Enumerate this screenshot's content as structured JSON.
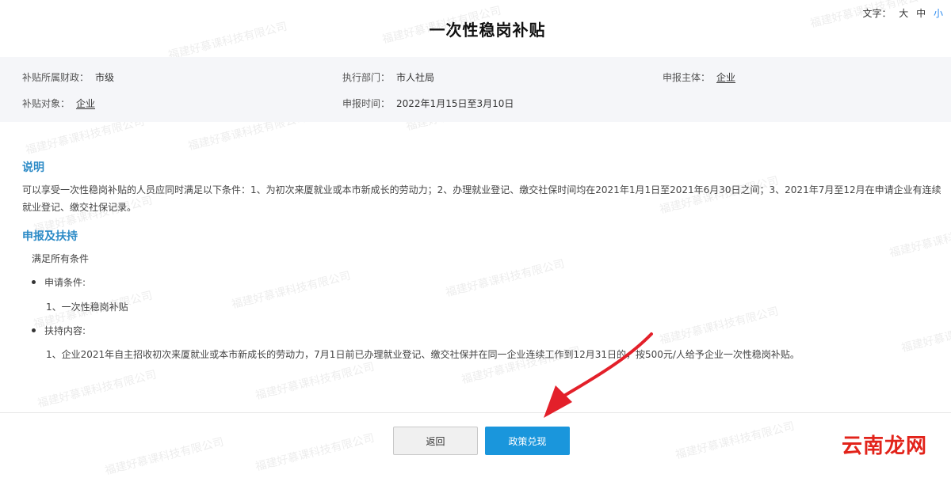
{
  "font_switch": {
    "label": "文字：",
    "large": "大",
    "medium": "中",
    "small": "小"
  },
  "title": "一次性稳岗补贴",
  "meta": {
    "finance": {
      "key": "补贴所属财政：",
      "value": "市级"
    },
    "dept": {
      "key": "执行部门：",
      "value": "市人社局"
    },
    "applicant": {
      "key": "申报主体：",
      "value": "企业"
    },
    "target": {
      "key": "补贴对象：",
      "value": "企业"
    },
    "time": {
      "key": "申报时间：",
      "value": "2022年1月15日至3月10日"
    }
  },
  "explain": {
    "title": "说明",
    "text": "可以享受一次性稳岗补贴的人员应同时满足以下条件：1、为初次来厦就业或本市新成长的劳动力；2、办理就业登记、缴交社保时间均在2021年1月1日至2021年6月30日之间；3、2021年7月至12月在申请企业有连续就业登记、缴交社保记录。"
  },
  "support": {
    "title": "申报及扶持",
    "condition_all": "满足所有条件",
    "apply_label": "申请条件:",
    "apply_item": "1、一次性稳岗补贴",
    "support_label": "扶持内容:",
    "support_item": "1、企业2021年自主招收初次来厦就业或本市新成长的劳动力，7月1日前已办理就业登记、缴交社保并在同一企业连续工作到12月31日的，按500元/人给予企业一次性稳岗补贴。"
  },
  "buttons": {
    "back": "返回",
    "cash": "政策兑现"
  },
  "watermark_text": "福建好慕课科技有限公司",
  "site_logo": "云南龙网",
  "colors": {
    "accent": "#2b8ac6",
    "primary_button": "#1a96dc",
    "arrow": "#e3202a"
  }
}
